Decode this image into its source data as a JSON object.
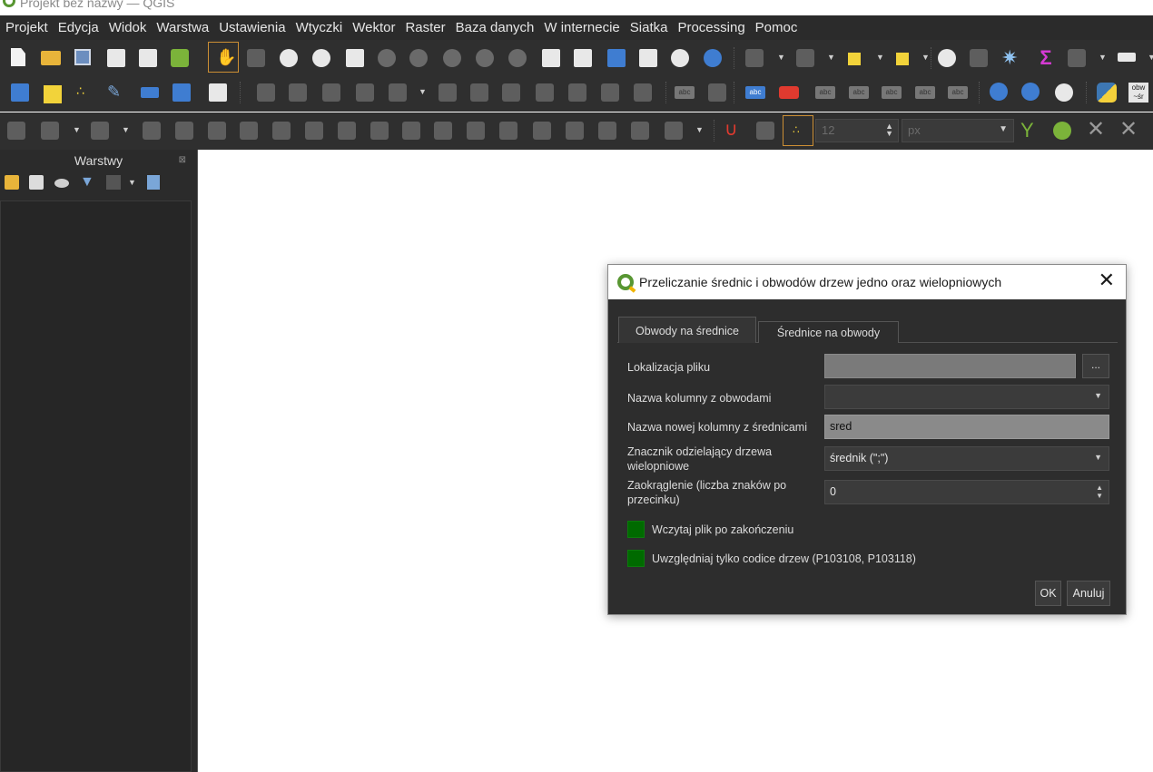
{
  "app": {
    "window_title": "Projekt bez nazwy — QGIS"
  },
  "menubar": {
    "items": [
      "Projekt",
      "Edycja",
      "Widok",
      "Warstwa",
      "Ustawienia",
      "Wtyczki",
      "Wektor",
      "Raster",
      "Baza danych",
      "W internecie",
      "Siatka",
      "Processing",
      "Pomoc"
    ]
  },
  "toolbars": {
    "snapping_tolerance_value": "12",
    "snapping_units_value": "px",
    "python_button_label": "obw ~śr",
    "label_icon_text": "abc"
  },
  "layers_panel": {
    "title": "Warstwy"
  },
  "dialog": {
    "title": "Przeliczanie średnic i obwodów drzew jedno oraz wielopniowych",
    "tabs": [
      {
        "label": "Obwody na średnice",
        "active": true
      },
      {
        "label": "Średnice na obwody",
        "active": false
      }
    ],
    "fields": {
      "file_location": {
        "label": "Lokalizacja pliku",
        "value": "",
        "browse_label": "..."
      },
      "circumference_column": {
        "label": "Nazwa kolumny z obwodami",
        "value": ""
      },
      "new_diameter_column": {
        "label": "Nazwa nowej kolumny z średnicami",
        "value": "sred"
      },
      "multistem_separator": {
        "label": "Znacznik odzielający drzewa wielopniowe",
        "value": "średnik (\";\")"
      },
      "rounding": {
        "label": "Zaokrąglenie (liczba znaków po przecinku)",
        "value": "0"
      }
    },
    "checkboxes": [
      {
        "label": "Wczytaj plik po zakończeniu",
        "checked": true
      },
      {
        "label": "Uwzględniaj tylko codice drzew (P103108, P103118)",
        "checked": true
      }
    ],
    "buttons": {
      "ok": "OK",
      "cancel": "Anuluj"
    }
  },
  "colors": {
    "qgis_green": "#589632",
    "checkbox_green": "#006a00",
    "active_tool_border": "#cc8f34",
    "dark_bg": "#2b2b2b"
  }
}
